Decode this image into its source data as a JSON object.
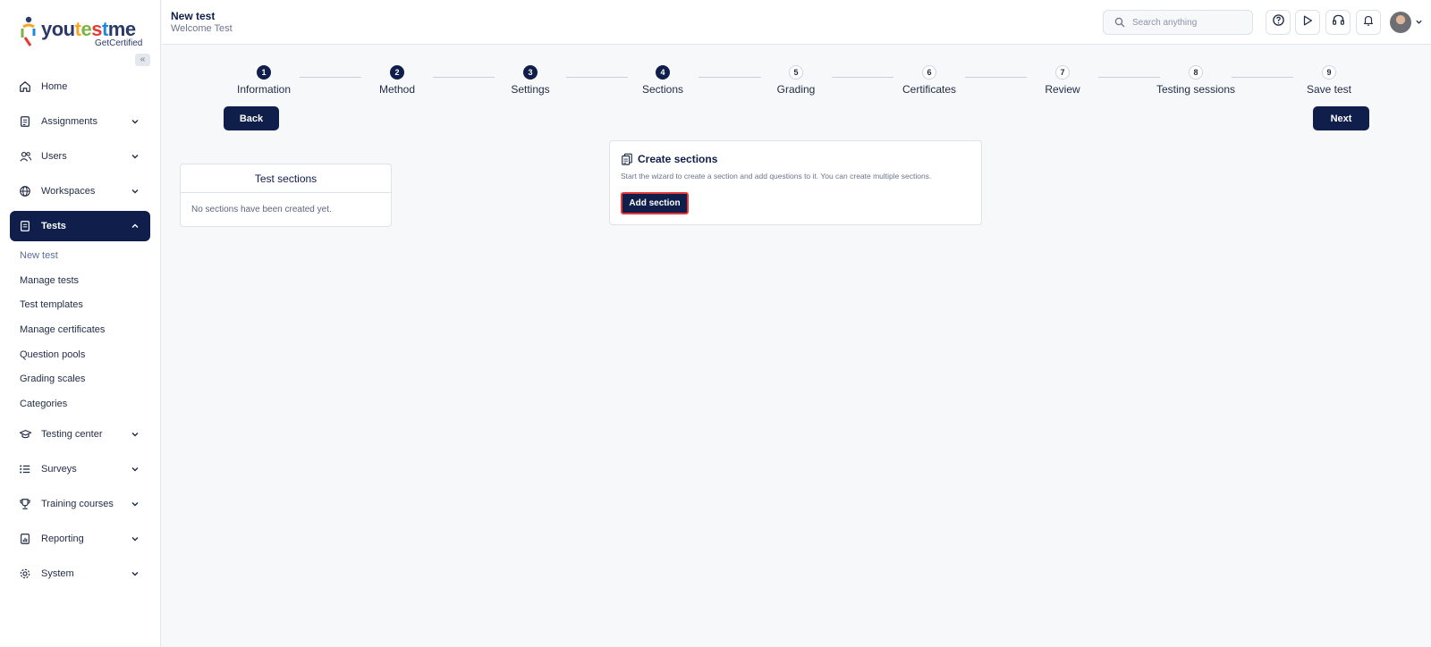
{
  "brand": {
    "logo_word_parts": [
      "you",
      "t",
      "e",
      "s",
      "t",
      "me"
    ],
    "logo_sub": "GetCertified"
  },
  "sidebar": {
    "collapse_label": "«",
    "items": [
      {
        "label": "Home",
        "icon": "home-icon",
        "chevron": false
      },
      {
        "label": "Assignments",
        "icon": "clipboard-icon",
        "chevron": true
      },
      {
        "label": "Users",
        "icon": "users-icon",
        "chevron": true
      },
      {
        "label": "Workspaces",
        "icon": "globe-icon",
        "chevron": true
      },
      {
        "label": "Tests",
        "icon": "test-doc-icon",
        "chevron": true,
        "active": true,
        "expanded": true
      },
      {
        "label": "Testing center",
        "icon": "graduation-cap-icon",
        "chevron": true
      },
      {
        "label": "Surveys",
        "icon": "list-icon",
        "chevron": true
      },
      {
        "label": "Training courses",
        "icon": "trophy-icon",
        "chevron": true
      },
      {
        "label": "Reporting",
        "icon": "report-icon",
        "chevron": true
      },
      {
        "label": "System",
        "icon": "gear-icon",
        "chevron": true
      }
    ],
    "tests_subitems": [
      {
        "label": "New test",
        "current": true
      },
      {
        "label": "Manage tests"
      },
      {
        "label": "Test templates"
      },
      {
        "label": "Manage certificates"
      },
      {
        "label": "Question pools"
      },
      {
        "label": "Grading scales"
      },
      {
        "label": "Categories"
      }
    ]
  },
  "header": {
    "title": "New test",
    "subtitle": "Welcome Test",
    "search_placeholder": "Search anything",
    "icons": [
      "help-icon",
      "play-icon",
      "headset-icon",
      "bell-icon"
    ]
  },
  "wizard": {
    "steps": [
      {
        "number": "1",
        "label": "Information",
        "done": true
      },
      {
        "number": "2",
        "label": "Method",
        "done": true
      },
      {
        "number": "3",
        "label": "Settings",
        "done": true
      },
      {
        "number": "4",
        "label": "Sections",
        "done": true
      },
      {
        "number": "5",
        "label": "Grading",
        "done": false
      },
      {
        "number": "6",
        "label": "Certificates",
        "done": false
      },
      {
        "number": "7",
        "label": "Review",
        "done": false
      },
      {
        "number": "8",
        "label": "Testing sessions",
        "done": false
      },
      {
        "number": "9",
        "label": "Save test",
        "done": false
      }
    ],
    "back_label": "Back",
    "next_label": "Next"
  },
  "test_sections": {
    "title": "Test sections",
    "empty_text": "No sections have been created yet."
  },
  "create_sections": {
    "title": "Create sections",
    "description": "Start the wizard to create a section and add questions to it. You can create multiple sections.",
    "button_label": "Add section"
  },
  "colors": {
    "primary": "#0f1e4a",
    "highlight_border": "#e53935",
    "background": "#f7f8fa"
  }
}
